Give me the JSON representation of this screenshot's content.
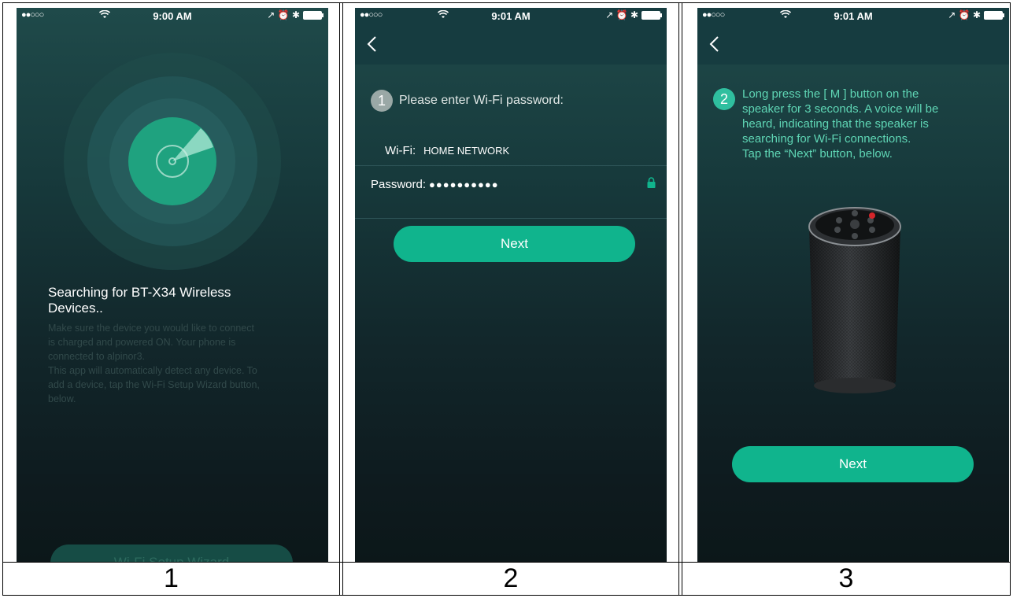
{
  "captions": [
    "1",
    "2",
    "3"
  ],
  "status": [
    {
      "signal": "●●○○○",
      "wifi": "ᯤ",
      "time": "9:00 AM",
      "right": "↗ ⏰ ✱"
    },
    {
      "signal": "●●○○○",
      "wifi": "ᯤ",
      "time": "9:01 AM",
      "right": "↗ ⏰ ✱"
    },
    {
      "signal": "●●○○○",
      "wifi": "ᯤ",
      "time": "9:01 AM",
      "right": "↗ ⏰ ✱"
    }
  ],
  "screen1": {
    "title_line1": "Searching for BT-X34 Wireless",
    "title_line2": "Devices..",
    "help1": "Make sure the device you would like to connect",
    "help2": "is charged and powered ON. Your phone is",
    "help3": "connected to alpinor3.",
    "help4": "This app will automatically detect any device. To",
    "help5": "add a device, tap the Wi-Fi Setup Wizard button,",
    "help6": "below.",
    "wizard_button": "Wi-Fi Setup Wizard"
  },
  "screen2": {
    "step_number": "1",
    "step_text": "Please enter Wi-Fi password:",
    "wifi_label": "Wi-Fi:",
    "wifi_value": "HOME NETWORK",
    "password_label": "Password:",
    "password_value": "●●●●●●●●●●",
    "next_button": "Next"
  },
  "screen3": {
    "step_number": "2",
    "line1": "Long press the [ M ] button on the",
    "line2": "speaker for 3 seconds. A voice will be",
    "line3": "heard, indicating that the speaker is",
    "line4": "searching for Wi-Fi connections.",
    "line5": "Tap the “Next” button, below.",
    "next_button": "Next"
  },
  "colors": {
    "accent": "#10b48d",
    "step_teal": "#2fbf9f",
    "step_gray": "#9aa8a6",
    "text_teal": "#5fd6b5"
  }
}
